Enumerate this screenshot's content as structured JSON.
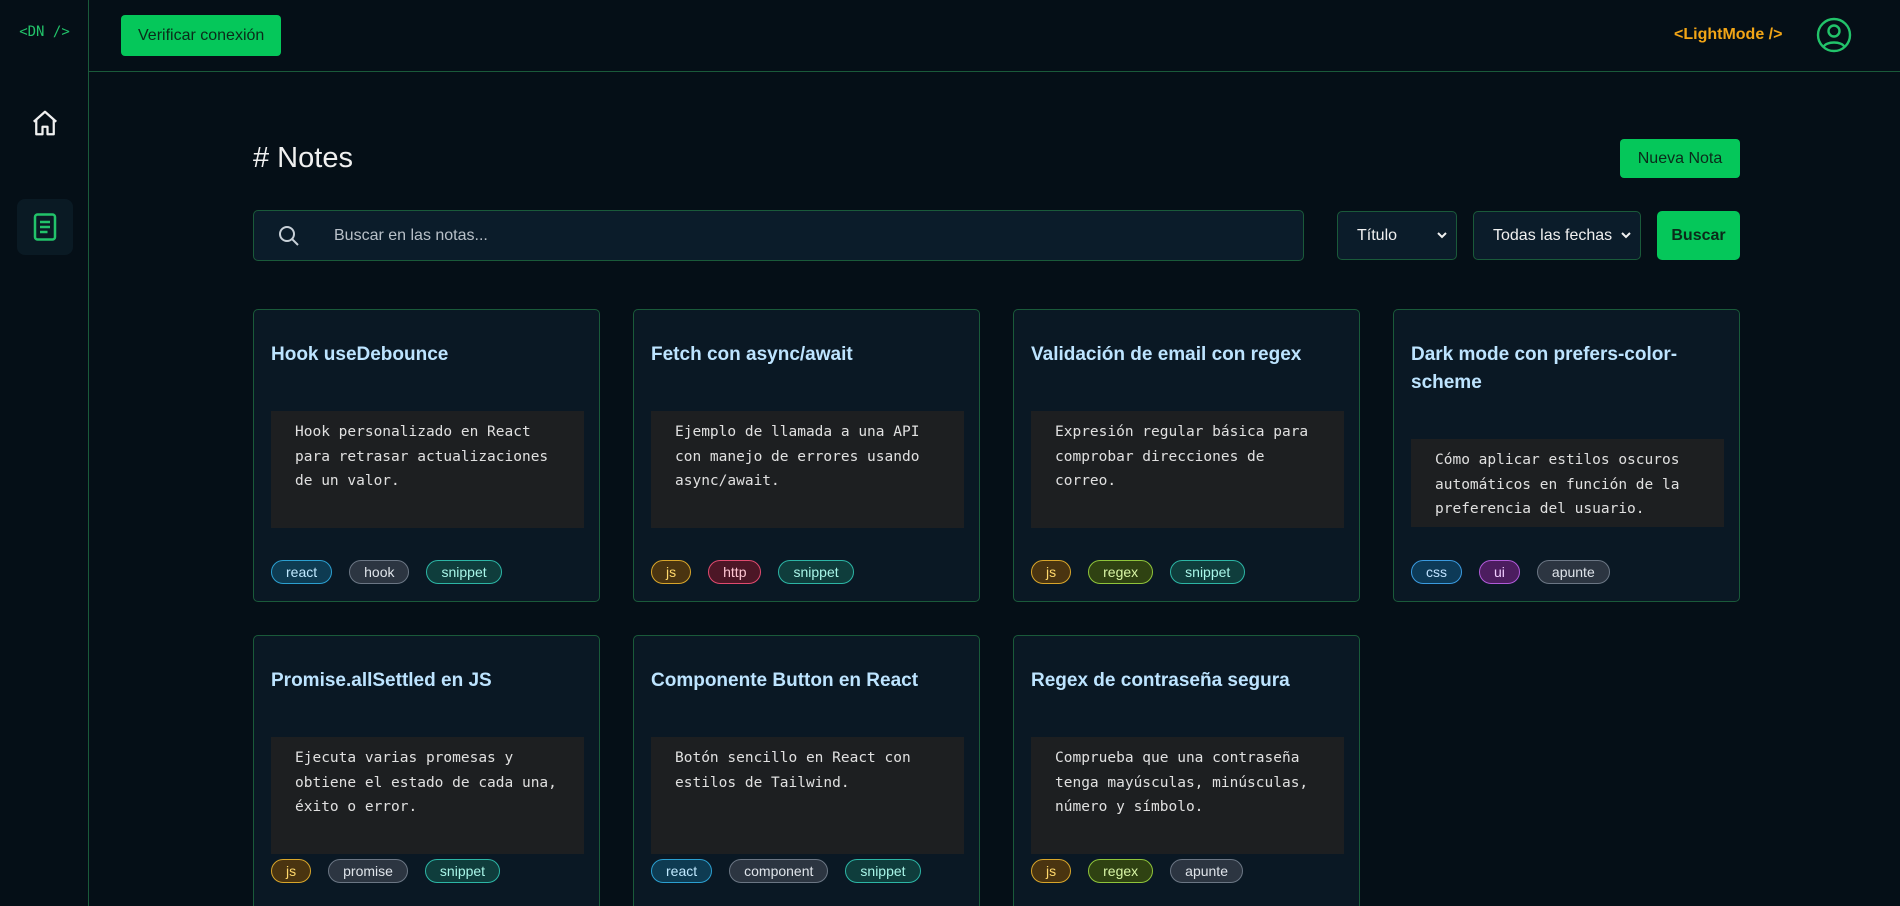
{
  "sidebar": {
    "logo": "<DN />",
    "items": [
      {
        "name": "home",
        "icon": "home-icon"
      },
      {
        "name": "notes",
        "icon": "notes-icon",
        "active": true
      }
    ]
  },
  "topbar": {
    "verify_label": "Verificar conexión",
    "lightmode_label": "<LightMode />",
    "avatar_icon": "user-circle-icon"
  },
  "main": {
    "title": "# Notes",
    "new_note_label": "Nueva Nota",
    "search": {
      "placeholder": "Buscar en las notas...",
      "value": ""
    },
    "filters": {
      "field": "Título",
      "date": "Todas las fechas"
    },
    "search_button": "Buscar"
  },
  "notes": [
    {
      "title": "Hook useDebounce",
      "desc": "Hook personalizado en React para retrasar actualizaciones de un valor.",
      "tags": [
        "react",
        "hook",
        "snippet"
      ]
    },
    {
      "title": "Fetch con async/await",
      "desc": "Ejemplo de llamada a una API con manejo de errores usando async/await.",
      "tags": [
        "js",
        "http",
        "snippet"
      ]
    },
    {
      "title": "Validación de email con regex",
      "desc": "Expresión regular básica para comprobar direcciones de correo.",
      "tags": [
        "js",
        "regex",
        "snippet"
      ]
    },
    {
      "title": "Dark mode con prefers-color-scheme",
      "desc": "Cómo aplicar estilos oscuros automáticos en función de la preferencia del usuario.",
      "tags": [
        "css",
        "ui",
        "apunte"
      ]
    },
    {
      "title": "Promise.allSettled en JS",
      "desc": "Ejecuta varias promesas y obtiene el estado de cada una, éxito o error.",
      "tags": [
        "js",
        "promise",
        "snippet"
      ]
    },
    {
      "title": "Componente Button en React",
      "desc": "Botón sencillo en React con estilos de Tailwind.",
      "tags": [
        "react",
        "component",
        "snippet"
      ]
    },
    {
      "title": "Regex de contraseña segura",
      "desc": "Comprueba que una contraseña tenga mayúsculas, minúsculas, número y símbolo.",
      "tags": [
        "js",
        "regex",
        "apunte"
      ]
    }
  ],
  "colors": {
    "accent": "#05c75a",
    "lightmode": "#f2a516",
    "border": "#1a5a3a",
    "background": "#050f17"
  }
}
